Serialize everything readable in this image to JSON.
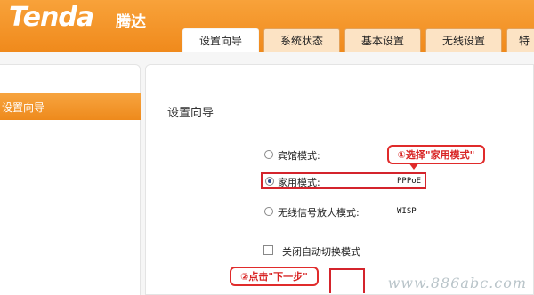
{
  "header": {
    "logo": "Tenda",
    "logo_cn": "腾达",
    "tabs": [
      {
        "label": "设置向导",
        "active": true
      },
      {
        "label": "系统状态",
        "active": false
      },
      {
        "label": "基本设置",
        "active": false
      },
      {
        "label": "无线设置",
        "active": false
      },
      {
        "label": "特",
        "active": false
      }
    ]
  },
  "sidebar": {
    "active_item": "设置向导"
  },
  "main": {
    "title": "设置向导",
    "options": [
      {
        "label": "宾馆模式:",
        "value": "",
        "checked": false
      },
      {
        "label": "家用模式:",
        "value": "PPPoE",
        "checked": true
      },
      {
        "label": "无线信号放大模式:",
        "value": "WISP",
        "checked": false
      }
    ],
    "checkbox_label": "关闭自动切换模式",
    "callout1": "①选择\"家用模式\"",
    "callout2": "②点击\"下一步\""
  },
  "watermark": "www.886abc.com",
  "colors": {
    "accent": "#f08a1c",
    "highlight": "#d4242c"
  }
}
